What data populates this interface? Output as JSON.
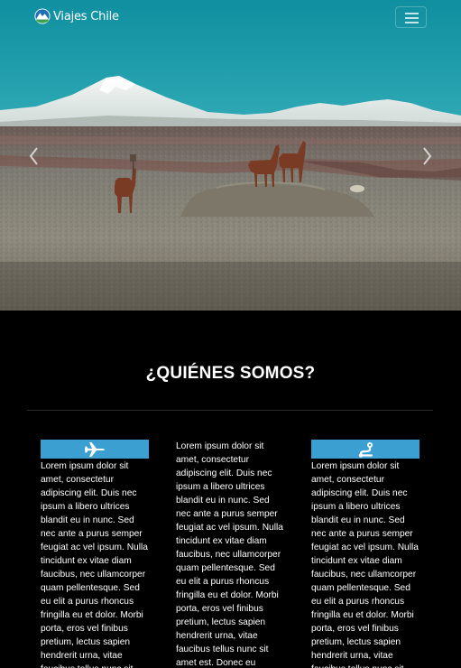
{
  "navbar": {
    "brand_text": "Viajes Chile",
    "brand_icon": "mountain-globe-logo",
    "toggler_icon": "hamburger-icon"
  },
  "carousel": {
    "prev_icon": "chevron-left-icon",
    "next_icon": "chevron-right-icon",
    "slide_description": "llamas-desert-volcano"
  },
  "about": {
    "title": "¿QUIÉNES SOMOS?",
    "accent_color": "#3b9fd1",
    "columns": [
      {
        "icon": "airplane-icon",
        "text": "Lorem ipsum dolor sit amet, consectetur adipiscing elit. Duis nec ipsum a libero ultrices blandit eu in nunc. Sed nec ante a purus semper feugiat ac vel ipsum. Nulla tincidunt ex vitae diam faucibus, nec ullamcorper quam pellentesque. Sed eu elit a purus rhoncus fringilla eu et dolor. Morbi porta, eros vel finibus pretium, lectus sapien hendrerit urna, vitae faucibus tellus nunc sit amet est. Donec eu"
      },
      {
        "icon": "",
        "text": "Lorem ipsum dolor sit amet, consectetur adipiscing elit. Duis nec ipsum a libero ultrices blandit eu in nunc. Sed nec ante a purus semper feugiat ac vel ipsum. Nulla tincidunt ex vitae diam faucibus, nec ullamcorper quam pellentesque. Sed eu elit a purus rhoncus fringilla eu et dolor. Morbi porta, eros vel finibus pretium, lectus sapien hendrerit urna, vitae faucibus tellus nunc sit amet est. Donec eu"
      },
      {
        "icon": "route-icon",
        "text": "Lorem ipsum dolor sit amet, consectetur adipiscing elit. Duis nec ipsum a libero ultrices blandit eu in nunc. Sed nec ante a purus semper feugiat ac vel ipsum. Nulla tincidunt ex vitae diam faucibus, nec ullamcorper quam pellentesque. Sed eu elit a purus rhoncus fringilla eu et dolor. Morbi porta, eros vel finibus pretium, lectus sapien hendrerit urna, vitae faucibus tellus nunc sit amet est. Donec eu"
      }
    ]
  }
}
